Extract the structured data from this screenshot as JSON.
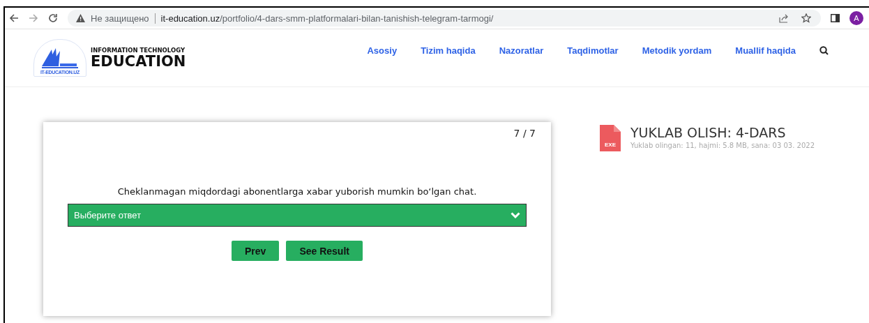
{
  "browser": {
    "security_label": "Не защищено",
    "url_host": "it-education.uz",
    "url_path": "/portfolio/4-dars-smm-platformalari-bilan-tanishish-telegram-tarmogi/",
    "avatar": "A"
  },
  "site_header": {
    "logo": {
      "badge": "IT-EDUCATION.UZ",
      "tagline": "INFORMATION TECHNOLOGY",
      "name": "EDUCATION"
    },
    "nav": [
      {
        "label": "Asosiy"
      },
      {
        "label": "Tizim haqida"
      },
      {
        "label": "Nazoratlar"
      },
      {
        "label": "Taqdimotlar"
      },
      {
        "label": "Metodik yordam"
      },
      {
        "label": "Muallif haqida"
      }
    ]
  },
  "quiz": {
    "counter": "7 / 7",
    "question": "Cheklanmagan miqdordagi abonentlarga xabar yuborish mumkin bo‘lgan chat.",
    "answer_select": "Выберите ответ",
    "buttons": [
      {
        "label": "Prev"
      },
      {
        "label": "See Result"
      }
    ]
  },
  "download": {
    "file_type": "EXE",
    "title": "YUKLAB OLISH: 4-DARS",
    "meta": "Yuklab olingan: 11, hajmi: 5.8 MB, sana: 03 03. 2022"
  }
}
